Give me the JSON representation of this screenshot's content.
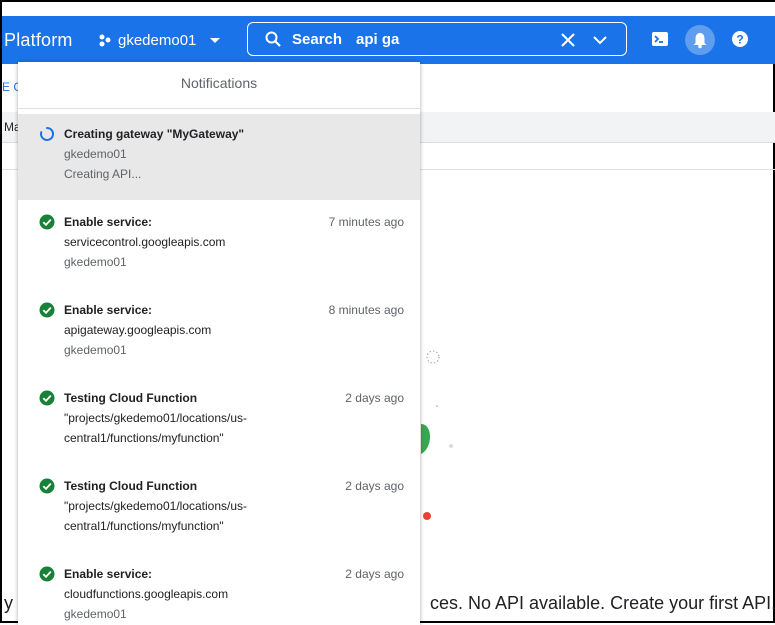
{
  "header": {
    "brand": "Platform",
    "project": "gkedemo01",
    "search_label": "Search",
    "search_value": "api ga"
  },
  "background": {
    "link_fragment": "E G",
    "table_header_fragment": "Ma",
    "empty_state_left": "y",
    "empty_state_message": "ces. No API available. Create your first API."
  },
  "notifications": {
    "title": "Notifications",
    "items": [
      {
        "title": "Creating gateway \"MyGateway\"",
        "line2": "gkedemo01",
        "line3": "Creating API...",
        "time": "",
        "status": "in-progress"
      },
      {
        "title": "Enable service:",
        "line2": "servicecontrol.googleapis.com",
        "line3": "gkedemo01",
        "time": "7 minutes ago",
        "status": "success"
      },
      {
        "title": "Enable service:",
        "line2": "apigateway.googleapis.com",
        "line3": "gkedemo01",
        "time": "8 minutes ago",
        "status": "success"
      },
      {
        "title": "Testing Cloud Function",
        "line2": "\"projects/gkedemo01/locations/us-",
        "line3": "central1/functions/myfunction\"",
        "time": "2 days ago",
        "status": "success"
      },
      {
        "title": "Testing Cloud Function",
        "line2": "\"projects/gkedemo01/locations/us-",
        "line3": "central1/functions/myfunction\"",
        "time": "2 days ago",
        "status": "success"
      },
      {
        "title": "Enable service:",
        "line2": "cloudfunctions.googleapis.com",
        "line3": "gkedemo01",
        "time": "2 days ago",
        "status": "success"
      }
    ]
  },
  "colors": {
    "header_bg": "#1a73e8",
    "success": "#188038",
    "progress": "#1a73e8"
  }
}
